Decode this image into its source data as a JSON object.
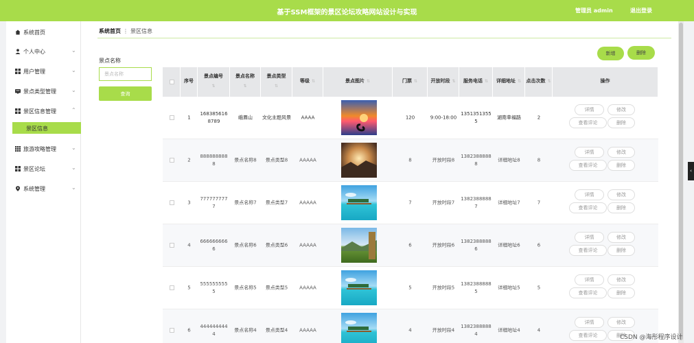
{
  "header": {
    "title": "基于SSM框架的景区论坛攻略网站设计与实现",
    "user": "管理员 admin",
    "logout": "退出登录"
  },
  "sidebar": {
    "items": [
      {
        "label": "系统首页",
        "icon": "home-icon"
      },
      {
        "label": "个人中心",
        "icon": "user-icon",
        "chevron": "⌄"
      },
      {
        "label": "用户管理",
        "icon": "grid-icon",
        "chevron": "⌄"
      },
      {
        "label": "景点类型管理",
        "icon": "tag-icon",
        "chevron": "⌄"
      },
      {
        "label": "景区信息管理",
        "icon": "grid-icon",
        "chevron": "⌃"
      },
      {
        "label": "景区信息",
        "selected": true
      },
      {
        "label": "旅游攻略管理",
        "icon": "apps-icon",
        "chevron": "⌄"
      },
      {
        "label": "景区论坛",
        "icon": "grid-icon",
        "chevron": "⌄"
      },
      {
        "label": "系统管理",
        "icon": "pin-icon",
        "chevron": "⌄"
      }
    ]
  },
  "breadcrumb": {
    "home": "系统首页",
    "sep": "⋮",
    "current": "景区信息"
  },
  "search": {
    "label": "景点名称",
    "placeholder": "景点名称",
    "button": "查询"
  },
  "actions": {
    "add": "新增",
    "delete": "删除"
  },
  "table": {
    "columns": [
      "序号",
      "景点编号",
      "景点名称",
      "景点类型",
      "等级",
      "景点图片",
      "门票",
      "开放时段",
      "服务电话",
      "详细地址",
      "点击次数",
      "操作"
    ],
    "sort_glyph": "⇅",
    "rows": [
      {
        "no": "1",
        "code": "1683856168789",
        "name": "峨眉山",
        "type": "文化主题风景",
        "level": "AAAA",
        "ticket": "120",
        "hours": "9:00-18:00",
        "phone": "13513513555",
        "address": "湖南幸福路",
        "clicks": "2",
        "img": "sunset"
      },
      {
        "no": "2",
        "code": "8888888888",
        "name": "景点名称8",
        "type": "景点类型8",
        "level": "AAAAA",
        "ticket": "8",
        "hours": "开放时段8",
        "phone": "13823888888",
        "address": "详细地址8",
        "clicks": "8",
        "img": "mist"
      },
      {
        "no": "3",
        "code": "7777777777",
        "name": "景点名称7",
        "type": "景点类型7",
        "level": "AAAAA",
        "ticket": "7",
        "hours": "开放时段7",
        "phone": "13823888887",
        "address": "详细地址7",
        "clicks": "7",
        "img": "beach"
      },
      {
        "no": "4",
        "code": "6666666666",
        "name": "景点名称6",
        "type": "景点类型6",
        "level": "AAAAA",
        "ticket": "6",
        "hours": "开放时段6",
        "phone": "13823888886",
        "address": "详细地址6",
        "clicks": "6",
        "img": "meadow"
      },
      {
        "no": "5",
        "code": "5555555555",
        "name": "景点名称5",
        "type": "景点类型5",
        "level": "AAAAA",
        "ticket": "5",
        "hours": "开放时段5",
        "phone": "13823888885",
        "address": "详细地址5",
        "clicks": "5",
        "img": "beach"
      },
      {
        "no": "6",
        "code": "4444444444",
        "name": "景点名称4",
        "type": "景点类型4",
        "level": "AAAAA",
        "ticket": "4",
        "hours": "开放时段4",
        "phone": "13823888884",
        "address": "详细地址4",
        "clicks": "4",
        "img": "beach"
      }
    ],
    "ops": {
      "detail": "详情",
      "edit": "修改",
      "comments": "查看评论",
      "delete": "删除"
    }
  },
  "side_tab": "‹",
  "watermark": "CSDN @海彤程序设计",
  "colors": {
    "accent": "#a8dc4a",
    "header_bg": "#a8dc4a",
    "table_head": "#e6e7e9"
  }
}
